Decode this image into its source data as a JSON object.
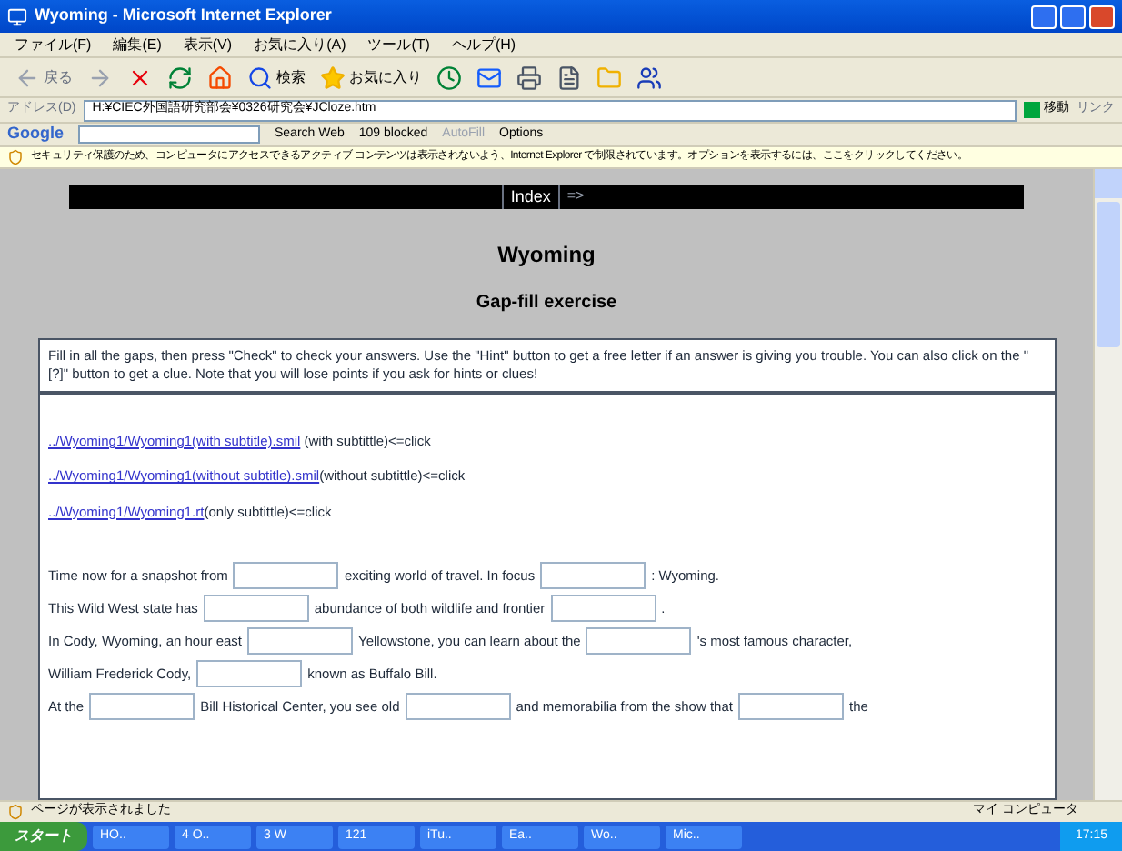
{
  "window": {
    "title": "Wyoming - Microsoft Internet Explorer"
  },
  "menu": [
    "ファイル(F)",
    "編集(E)",
    "表示(V)",
    "お気に入り(A)",
    "ツール(T)",
    "ヘルプ(H)"
  ],
  "toolbar": {
    "back": "戻る",
    "search": "検索",
    "favorites": "お気に入り"
  },
  "address": {
    "label": "アドレス(D)",
    "value": "H:¥CIEC外国語研究部会¥0326研究会¥JCloze.htm",
    "go": "移動",
    "links": "リンク"
  },
  "google_bar": {
    "logo": "Google",
    "search": "Search Web",
    "blocked": "109 blocked",
    "autofill": "AutoFill",
    "options": "Options"
  },
  "info_bar": "セキュリティ保護のため、コンピュータにアクセスできるアクティブ コンテンツは表示されないよう、Internet Explorer で制限されています。オプションを表示するには、ここをクリックしてください。",
  "page": {
    "nav": [
      "Index",
      "=>"
    ],
    "title": "Wyoming",
    "subtitle": "Gap-fill exercise",
    "instructions": "Fill in all the gaps, then press \"Check\" to check your answers. Use the \"Hint\" button to get a free letter if an answer is giving you trouble. You can also click on the \"[?]\" button to get a clue. Note that you will lose points if you ask for hints or clues!",
    "links": [
      {
        "href": "../Wyoming1/Wyoming1(with subtitle).smil",
        "note": " (with subtittle)<=click"
      },
      {
        "href": "../Wyoming1/Wyoming1(without subtitle).smil",
        "note": "(without subtittle)<=click"
      },
      {
        "href": "../Wyoming1/Wyoming1.rt",
        "note": "(only subtittle)<=click"
      }
    ],
    "lines": [
      [
        {
          "kind": "text",
          "text": "Time now for a snapshot from"
        },
        {
          "kind": "gap"
        },
        {
          "kind": "text",
          "text": "exciting world of travel. In focus"
        },
        {
          "kind": "gap"
        },
        {
          "kind": "text",
          "text": ": Wyoming."
        }
      ],
      [
        {
          "kind": "text",
          "text": "This Wild West state has"
        },
        {
          "kind": "gap"
        },
        {
          "kind": "text",
          "text": "abundance of both wildlife and frontier"
        },
        {
          "kind": "gap"
        },
        {
          "kind": "text",
          "text": "."
        }
      ],
      [
        {
          "kind": "text",
          "text": "In Cody, Wyoming, an hour east"
        },
        {
          "kind": "gap"
        },
        {
          "kind": "text",
          "text": "Yellowstone, you can learn about the"
        },
        {
          "kind": "gap"
        },
        {
          "kind": "text",
          "text": "'s most famous character,"
        }
      ],
      [
        {
          "kind": "text",
          "text": "William Frederick Cody,"
        },
        {
          "kind": "gap"
        },
        {
          "kind": "text",
          "text": "known as Buffalo Bill."
        }
      ],
      [
        {
          "kind": "text",
          "text": "At the"
        },
        {
          "kind": "gap"
        },
        {
          "kind": "text",
          "text": "Bill Historical Center, you see old"
        },
        {
          "kind": "gap"
        },
        {
          "kind": "text",
          "text": "and memorabilia from the show that"
        },
        {
          "kind": "gap"
        },
        {
          "kind": "text",
          "text": "the"
        }
      ]
    ]
  },
  "status_bar": {
    "text": "ページが表示されました",
    "zone": "マイ コンピュータ"
  },
  "taskbar": {
    "start": "スタート",
    "items": [
      "HO..",
      "4 O..",
      "3 W",
      "121",
      "iTu..",
      "Ea..",
      "Wo..",
      "Mic.."
    ],
    "clock": "17:15"
  }
}
